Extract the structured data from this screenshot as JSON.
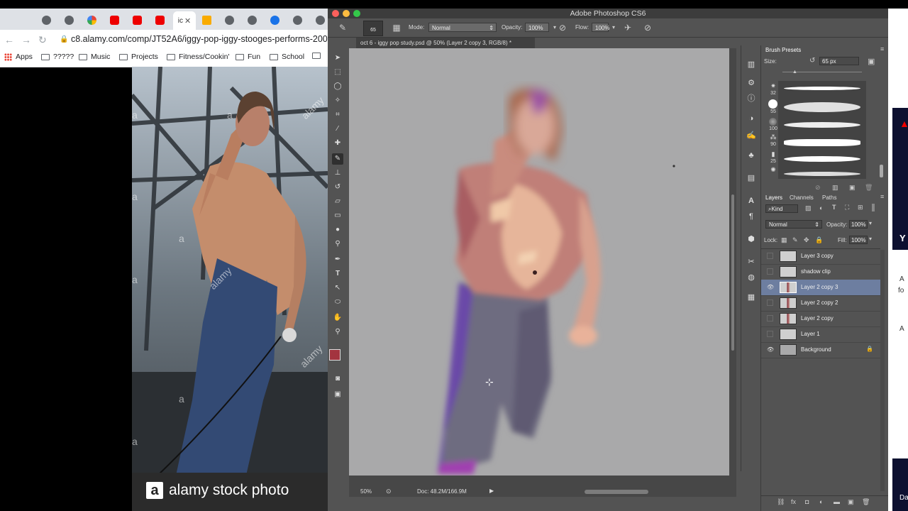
{
  "browser": {
    "url": "c8.alamy.com/comp/JT52A6/iggy-pop-iggy-stooges-performs-2007-i",
    "active_tab_label": "ic",
    "bookmarks": [
      {
        "label": "Apps"
      },
      {
        "label": "?????"
      },
      {
        "label": "Music"
      },
      {
        "label": "Projects"
      },
      {
        "label": "Fitness/Cookin'"
      },
      {
        "label": "Fun"
      },
      {
        "label": "School"
      }
    ],
    "watermark_letter": "a",
    "watermark_word": "alamy",
    "footer_logo": "a",
    "footer_text": "alamy stock photo"
  },
  "photoshop": {
    "title": "Adobe Photoshop CS6",
    "options": {
      "brush_size": "65",
      "mode_label": "Mode:",
      "mode_value": "Normal",
      "opacity_label": "Opacity:",
      "opacity_value": "100%",
      "flow_label": "Flow:",
      "flow_value": "100%"
    },
    "document_tab": "oct 6 - iggy pop study.psd @ 50% (Layer 2 copy 3, RGB/8) *",
    "status": {
      "zoom": "50%",
      "doc_size": "Doc: 48.2M/166.9M"
    },
    "brush_presets": {
      "tab": "Brush Presets",
      "size_label": "Size:",
      "size_value": "65 px",
      "sizes": [
        "32",
        "55",
        "",
        "100",
        "90",
        "25"
      ]
    },
    "layers": {
      "tabs": [
        "Layers",
        "Channels",
        "Paths"
      ],
      "kind_label": "Kind",
      "blend_mode": "Normal",
      "opacity_label": "Opacity:",
      "opacity_value": "100%",
      "lock_label": "Lock:",
      "fill_label": "Fill:",
      "fill_value": "100%",
      "items": [
        {
          "name": "Layer 3 copy"
        },
        {
          "name": "shadow clip"
        },
        {
          "name": "Layer 2 copy 3"
        },
        {
          "name": "Layer 2 copy 2"
        },
        {
          "name": "Layer 2 copy"
        },
        {
          "name": "Layer 1"
        },
        {
          "name": "Background"
        }
      ]
    }
  },
  "right_window": {
    "letters": [
      "Y",
      "A",
      "fo",
      "A",
      "Da"
    ]
  }
}
